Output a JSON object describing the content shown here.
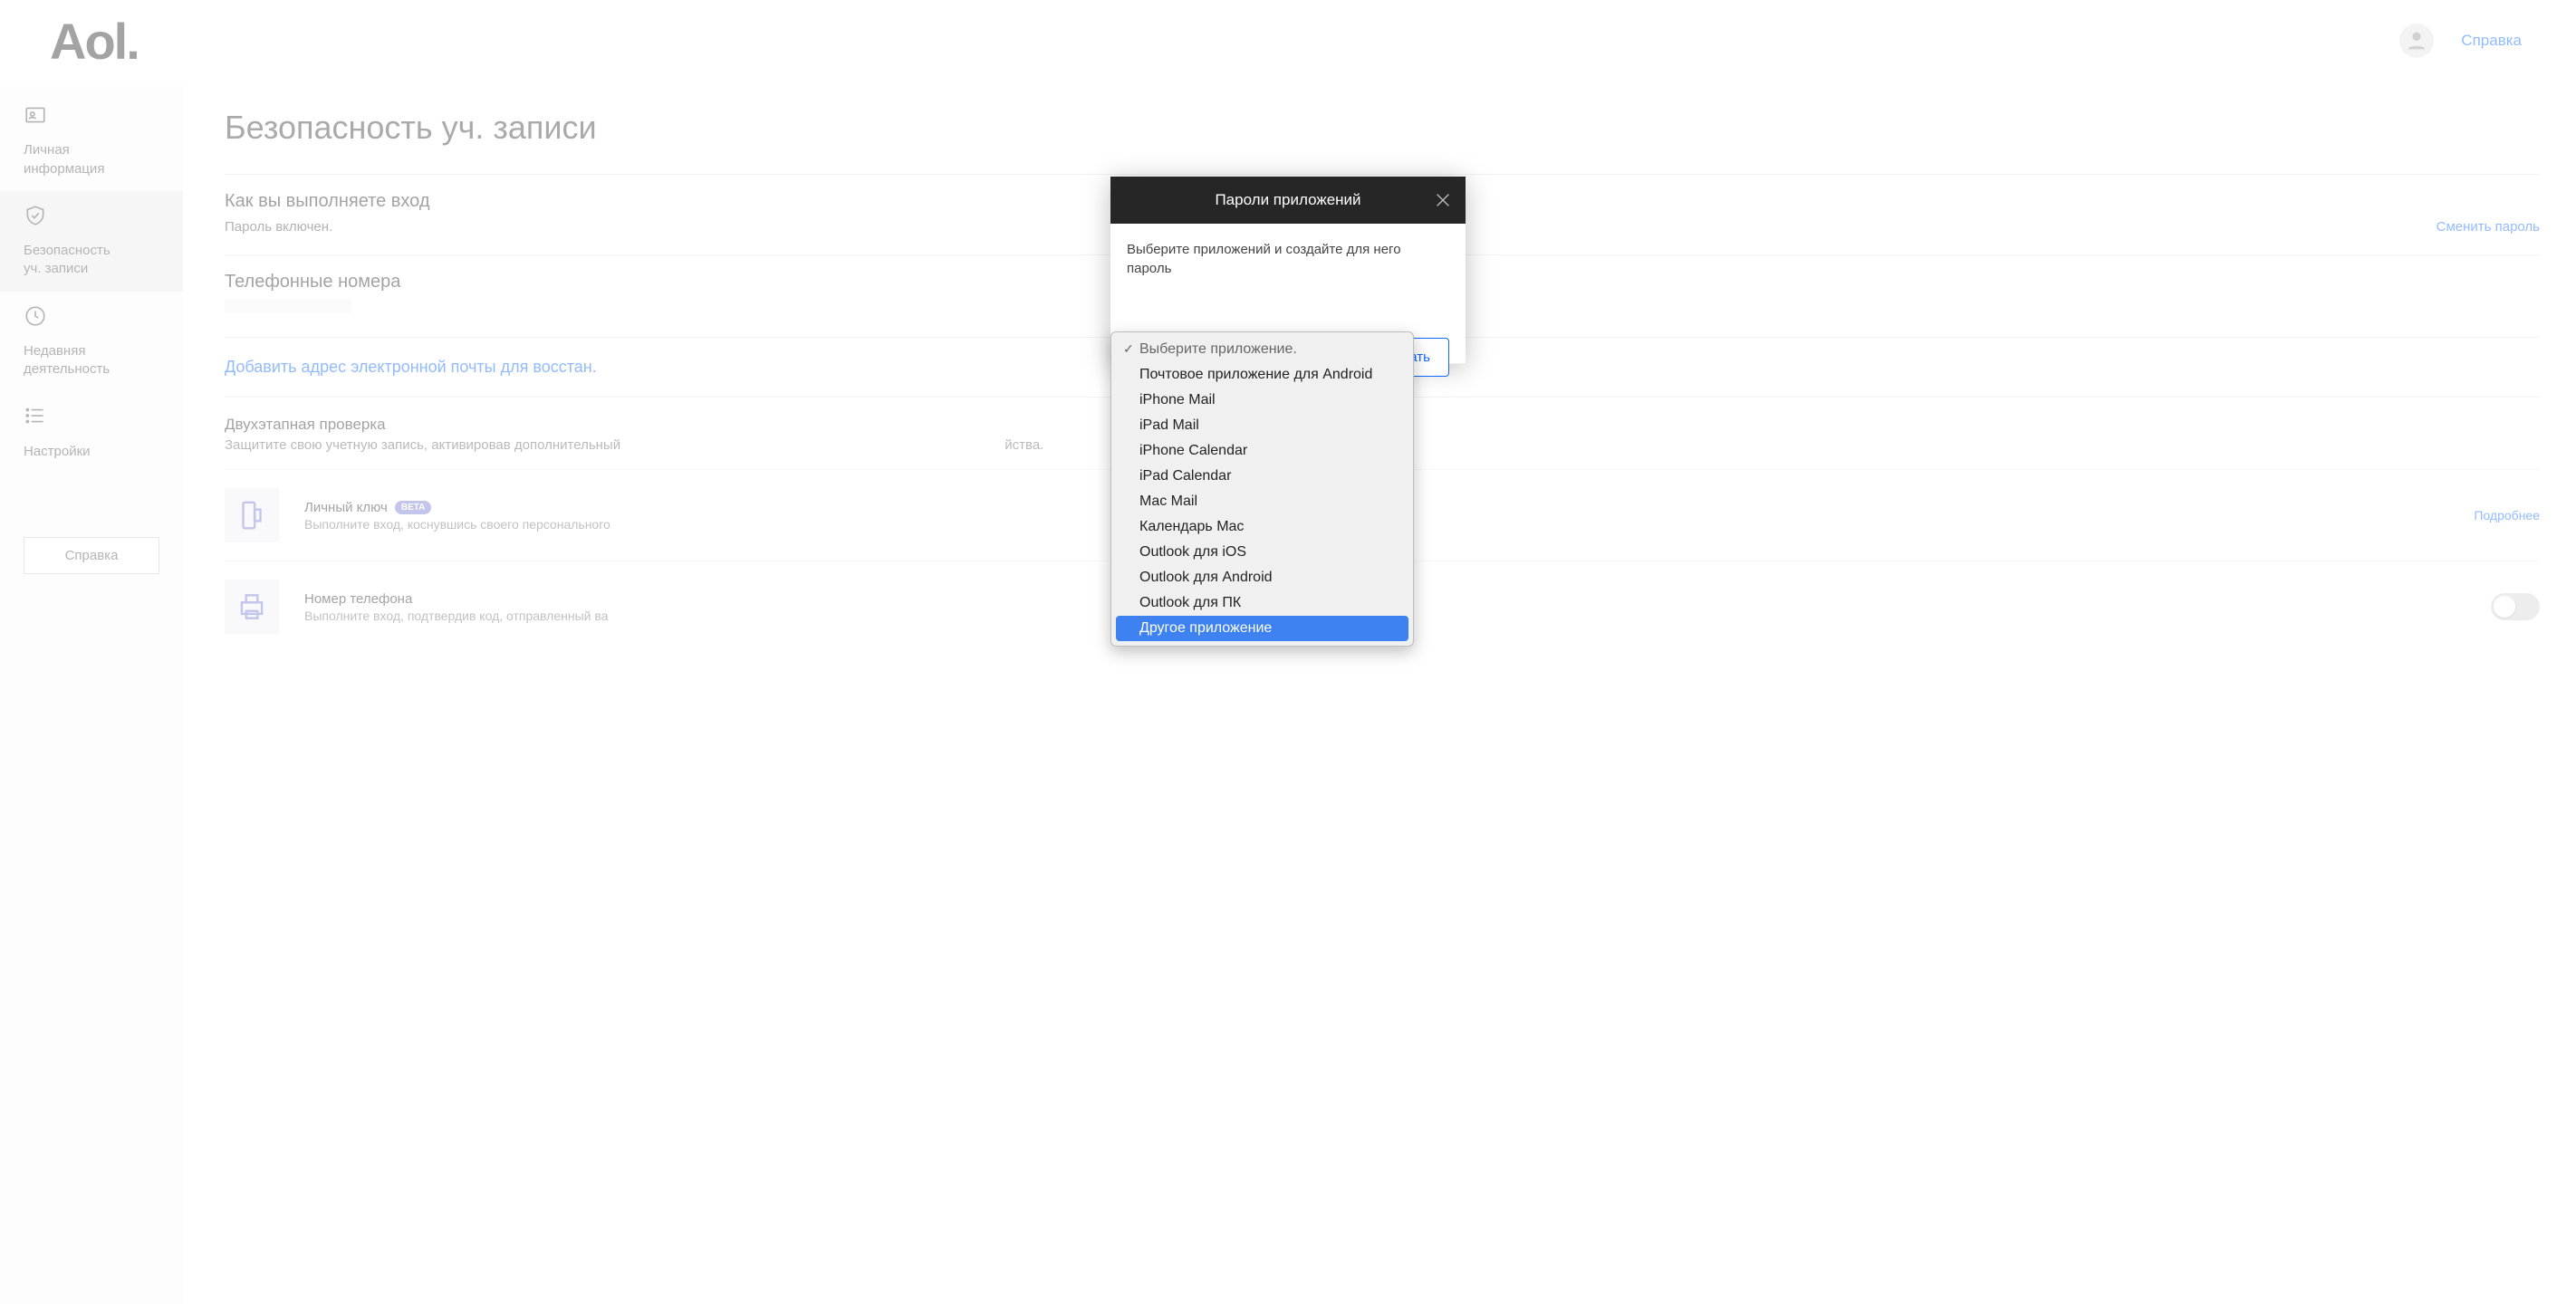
{
  "header": {
    "logo": "Aol.",
    "help": "Справка"
  },
  "sidebar": {
    "items": [
      {
        "label": "Личная\nинформация"
      },
      {
        "label": "Безопасность\nуч. записи"
      },
      {
        "label": "Недавняя\nдеятельность"
      },
      {
        "label": "Настройки"
      }
    ],
    "help_button": "Справка"
  },
  "page": {
    "title": "Безопасность уч. записи",
    "login_section": {
      "heading": "Как вы выполняете вход",
      "status": "Пароль включен.",
      "change": "Сменить пароль"
    },
    "phones_heading": "Телефонные номера",
    "add_email": "Добавить адрес электронной почты для восстан.",
    "twostep": {
      "heading": "Двухэтапная проверка",
      "sub": "Защитите свою учетную запись, активировав дополнительный",
      "sub_tail": "йства."
    },
    "methods": [
      {
        "title": "Личный ключ",
        "beta": "BETA",
        "desc": "Выполните вход, коснувшись своего персонального",
        "more": "Подробнее"
      },
      {
        "title": "Номер телефона",
        "desc": "Выполните вход, подтвердив код, отправленный ва"
      }
    ]
  },
  "modal": {
    "title": "Пароли приложений",
    "body": "Выберите приложений и создайте для него пароль",
    "create": "ать",
    "options": [
      "Выберите приложение.",
      "Почтовое приложение для Android",
      "iPhone Mail",
      "iPad Mail",
      "iPhone Calendar",
      "iPad Calendar",
      "Mac Mail",
      "Календарь Mac",
      "Outlook для iOS",
      "Outlook для Android",
      "Outlook для ПК",
      "Другое приложение"
    ]
  }
}
